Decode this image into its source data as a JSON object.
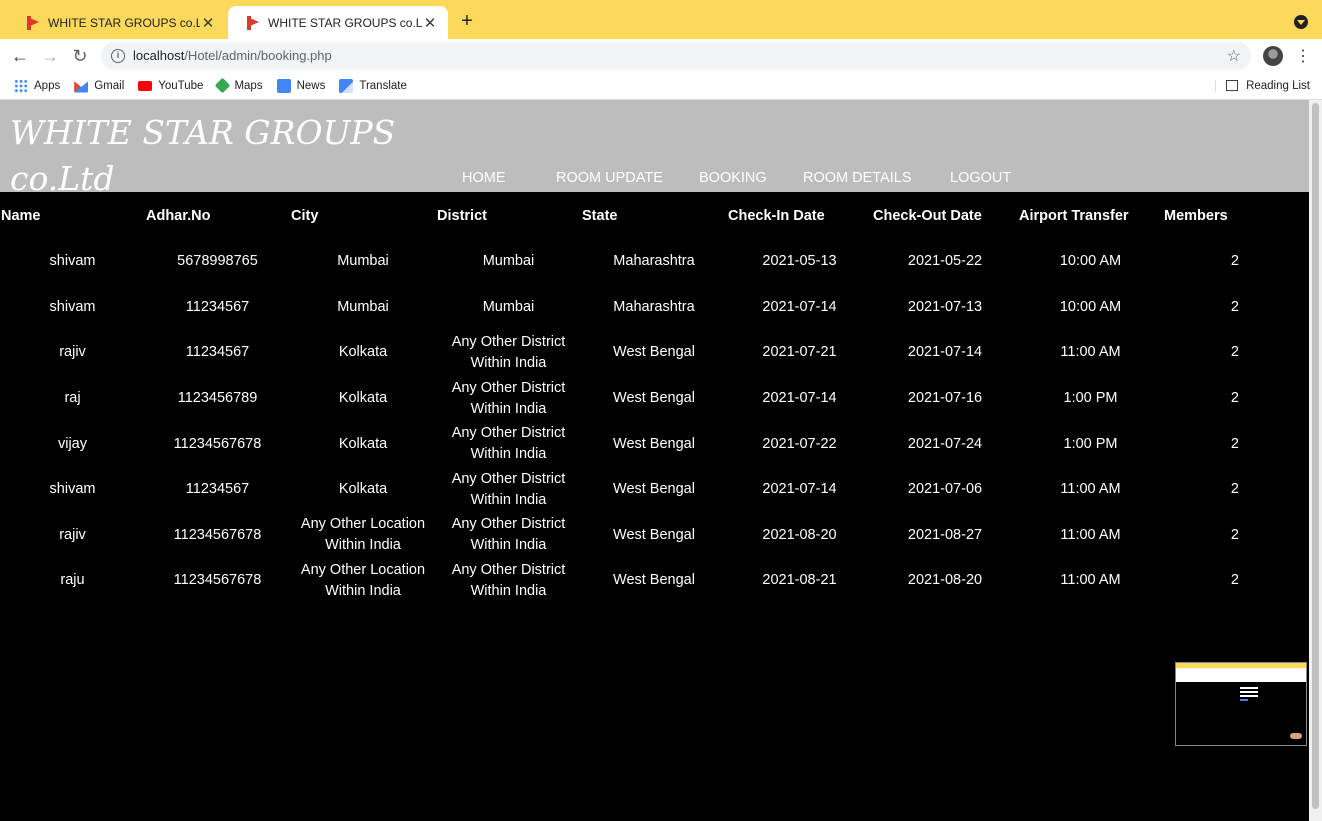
{
  "browser": {
    "tabs": [
      {
        "title": "WHITE STAR GROUPS co.Ltd",
        "active": false
      },
      {
        "title": "WHITE STAR GROUPS co.Ltd",
        "active": true
      }
    ],
    "new_tab": "+",
    "url_host": "localhost",
    "url_path": "/Hotel/admin/booking.php",
    "bookmarks": [
      {
        "label": "Apps",
        "icon": "apps-icon"
      },
      {
        "label": "Gmail",
        "icon": "gmail-icon"
      },
      {
        "label": "YouTube",
        "icon": "youtube-icon"
      },
      {
        "label": "Maps",
        "icon": "maps-icon"
      },
      {
        "label": "News",
        "icon": "news-icon"
      },
      {
        "label": "Translate",
        "icon": "translate-icon"
      }
    ],
    "reading_list": "Reading List",
    "accent_color": "#fcd95a"
  },
  "site": {
    "brand_line1": "WHITE STAR GROUPS",
    "brand_line2": "co.Ltd",
    "nav": [
      {
        "label": "HOME"
      },
      {
        "label": "ROOM UPDATE"
      },
      {
        "label": "BOOKING"
      },
      {
        "label": "ROOM DETAILS"
      },
      {
        "label": "LOGOUT"
      }
    ],
    "header_color": "#bdbdbd"
  },
  "table": {
    "columns": [
      "Name",
      "Adhar.No",
      "City",
      "District",
      "State",
      "Check-In Date",
      "Check-Out Date",
      "Airport Transfer",
      "Members"
    ],
    "rows": [
      [
        "shivam",
        "5678998765",
        "Mumbai",
        "Mumbai",
        "Maharashtra",
        "2021-05-13",
        "2021-05-22",
        "10:00 AM",
        "2"
      ],
      [
        "shivam",
        "11234567",
        "Mumbai",
        "Mumbai",
        "Maharashtra",
        "2021-07-14",
        "2021-07-13",
        "10:00 AM",
        "2"
      ],
      [
        "rajiv",
        "11234567",
        "Kolkata",
        "Any Other District Within India",
        "West Bengal",
        "2021-07-21",
        "2021-07-14",
        "11:00 AM",
        "2"
      ],
      [
        "raj",
        "1123456789",
        "Kolkata",
        "Any Other District Within India",
        "West Bengal",
        "2021-07-14",
        "2021-07-16",
        "1:00 PM",
        "2"
      ],
      [
        "vijay",
        "11234567678",
        "Kolkata",
        "Any Other District Within India",
        "West Bengal",
        "2021-07-22",
        "2021-07-24",
        "1:00 PM",
        "2"
      ],
      [
        "shivam",
        "11234567",
        "Kolkata",
        "Any Other District Within India",
        "West Bengal",
        "2021-07-14",
        "2021-07-06",
        "11:00 AM",
        "2"
      ],
      [
        "rajiv",
        "11234567678",
        "Any Other Location Within India",
        "Any Other District Within India",
        "West Bengal",
        "2021-08-20",
        "2021-08-27",
        "11:00 AM",
        "2"
      ],
      [
        "raju",
        "11234567678",
        "Any Other Location Within India",
        "Any Other District Within India",
        "West Bengal",
        "2021-08-21",
        "2021-08-20",
        "11:00 AM",
        "2"
      ]
    ]
  }
}
